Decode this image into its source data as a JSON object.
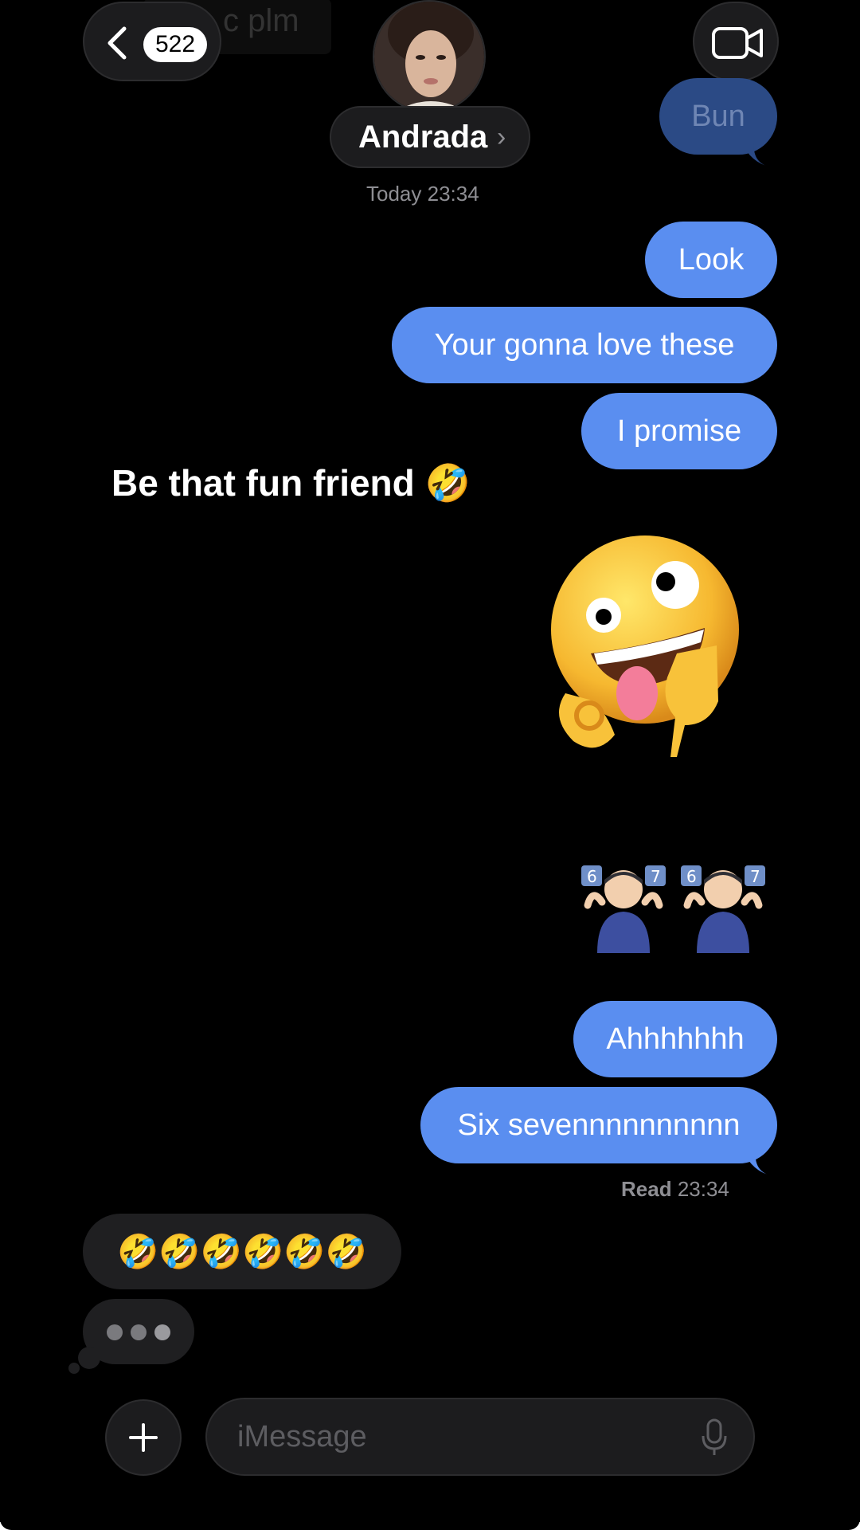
{
  "header": {
    "unread_count": "522",
    "contact_name": "Andrada",
    "ghost_preview": "c plm"
  },
  "top_partial_bubble": "Bun",
  "timestamp": "Today 23:34",
  "sent_messages": [
    "Look",
    "Your gonna love these",
    "I promise"
  ],
  "overlay_caption": "Be that fun friend 🤣",
  "emoji_stickers": {
    "big": "zany-face-emoji",
    "row_label": "6️⃣7️⃣"
  },
  "sent_messages_2": [
    "Ahhhhhhh",
    "Six sevennnnnnnnnn"
  ],
  "read_receipt": {
    "label": "Read",
    "time": "23:34"
  },
  "received_reactions": "🤣🤣🤣🤣🤣🤣",
  "composer": {
    "placeholder": "iMessage"
  },
  "colors": {
    "sent_bubble": "#5a8ef0",
    "received_bubble": "#1f1f21",
    "background": "#000000"
  }
}
